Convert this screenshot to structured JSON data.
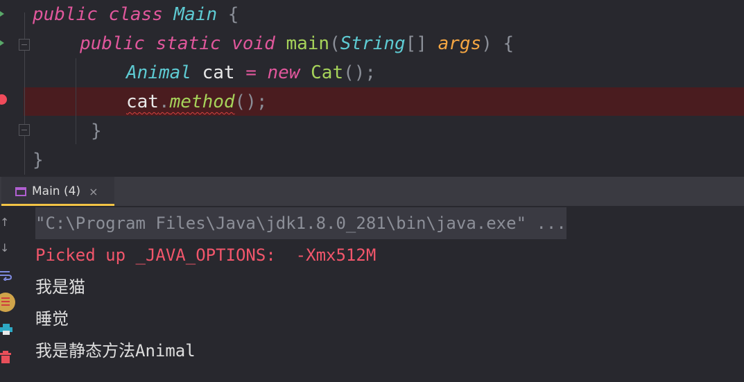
{
  "editor": {
    "lines": [
      {
        "t1": "public",
        "t2": "class",
        "t3": "Main",
        "t4": "{"
      },
      {
        "t1": "public",
        "t2": "static",
        "t3": "void",
        "t4": "main",
        "t5": "(",
        "t6": "String",
        "t7": "[]",
        "t8": "args",
        "t9": ")",
        "t10": "{"
      },
      {
        "t1": "Animal",
        "t2": "cat",
        "t3": "=",
        "t4": "new",
        "t5": "Cat",
        "t6": "();"
      },
      {
        "t1": "cat",
        "t2": ".",
        "t3": "method",
        "t4": "();"
      },
      {
        "t1": "}"
      },
      {
        "t1": "}"
      }
    ]
  },
  "run_panel": {
    "tab_label": "Main (4)",
    "tab_close": "×"
  },
  "console": {
    "lines": [
      "\"C:\\Program Files\\Java\\jdk1.8.0_281\\bin\\java.exe\" ...",
      "Picked up _JAVA_OPTIONS:  -Xmx512M",
      "我是猫",
      "睡觉",
      "我是静态方法Animal"
    ]
  },
  "colors": {
    "keyword": "#e1579c",
    "class": "#5ecbd3",
    "function": "#a6d35a",
    "param": "#f5a642",
    "error_text": "#f2566b",
    "breakpoint": "#f04b5b",
    "breakpoint_line": "#4a1c1f",
    "tab_underline": "#f3c445"
  },
  "icons": [
    "run-arrow-icon",
    "fold-icon",
    "breakpoint-icon",
    "run-tab-icon",
    "close-icon",
    "scroll-up-icon",
    "scroll-down-icon",
    "soft-wrap-icon",
    "scroll-to-end-icon",
    "print-icon",
    "trash-icon"
  ]
}
